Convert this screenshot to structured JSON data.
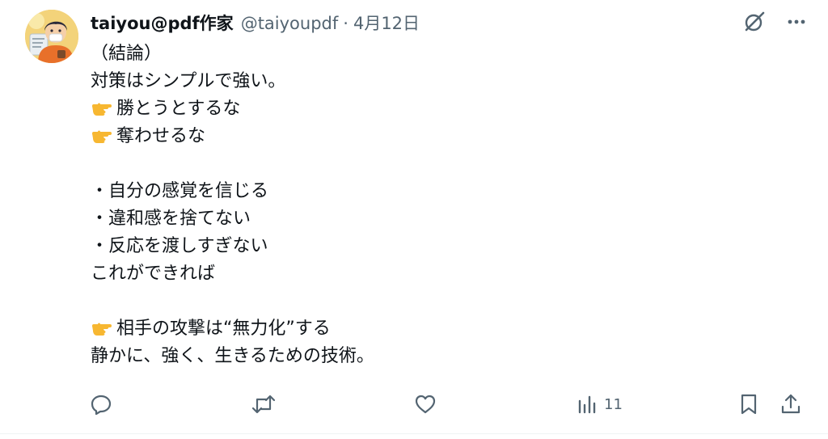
{
  "post": {
    "author": {
      "display_name": "taiyou@pdf作家",
      "handle": "@taiyoupdf",
      "avatar": "avatar-illustration"
    },
    "separator": "·",
    "date": "4月12日",
    "text_lines": [
      "（結論）",
      "対策はシンプルで強い。",
      "勝とうとするな",
      "奪わせるな",
      "",
      "・自分の感覚を信じる",
      "・違和感を捨てない",
      "・反応を渡しすぎない",
      "これができれば",
      "",
      "相手の攻撃は“無力化”する",
      "静かに、強く、生きるための技術。"
    ],
    "pointer_emoji_lines": [
      2,
      3,
      10
    ]
  },
  "top_actions": {
    "grok_icon": "grok-icon",
    "more_icon": "more-icon"
  },
  "actions": {
    "reply": {
      "icon": "reply-icon",
      "count": ""
    },
    "repost": {
      "icon": "repost-icon",
      "count": ""
    },
    "like": {
      "icon": "like-icon",
      "count": ""
    },
    "views": {
      "icon": "views-icon",
      "count": "11"
    },
    "bookmark": {
      "icon": "bookmark-icon"
    },
    "share": {
      "icon": "share-icon"
    }
  },
  "colors": {
    "text": "#0f1419",
    "secondary": "#536471",
    "background": "#ffffff",
    "divider": "#eff3f4"
  }
}
